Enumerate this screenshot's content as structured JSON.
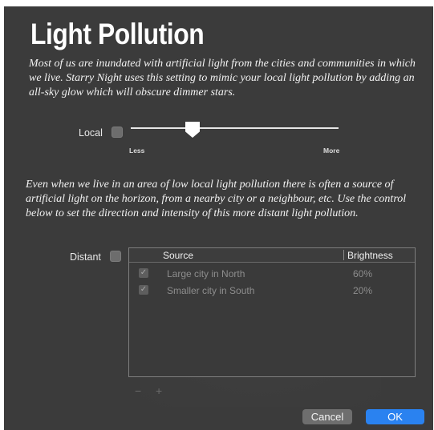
{
  "title": "Light Pollution",
  "intro_text": "Most of us are inundated with artificial light from the cities and communities in which we live. Starry Night uses this setting to mimic your local light pollution by adding an all-sky glow which will obscure dimmer stars.",
  "local": {
    "label": "Local",
    "checked": false,
    "slider_value_fraction": 0.28,
    "min_label": "Less",
    "max_label": "More"
  },
  "distant_text": "Even when we live in an area of low local light pollution there is often a source of artificial light on the horizon, from a nearby city or a neighbour, etc. Use the control below to set the direction and intensity of this more distant light pollution.",
  "distant": {
    "label": "Distant",
    "checked": false,
    "columns": {
      "source": "Source",
      "brightness": "Brightness"
    },
    "rows": [
      {
        "enabled": true,
        "source": "Large city in North",
        "brightness": "60%"
      },
      {
        "enabled": true,
        "source": "Smaller city in South",
        "brightness": "20%"
      }
    ],
    "remove_label": "−",
    "add_label": "+"
  },
  "buttons": {
    "cancel": "Cancel",
    "ok": "OK"
  },
  "colors": {
    "panel_bg": "#3b3b3b",
    "ok_button": "#2a82f0",
    "cancel_button": "#6e6e6e"
  }
}
